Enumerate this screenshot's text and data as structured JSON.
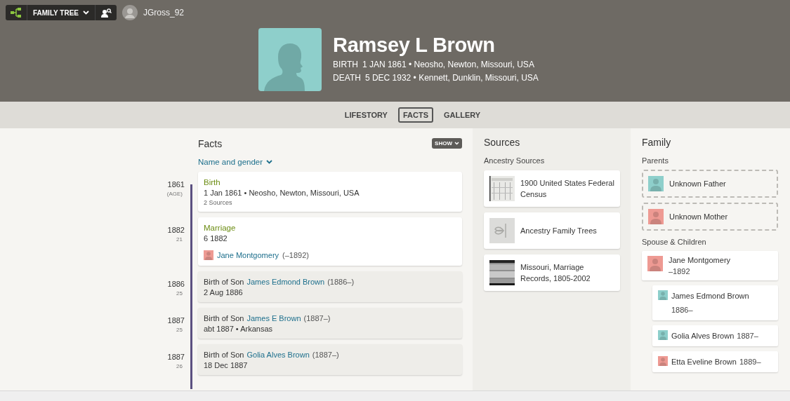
{
  "top_bar": {
    "menu_label": "FAMILY TREE",
    "username": "JGross_92"
  },
  "profile": {
    "name": "Ramsey L Brown",
    "color": "#8ecfcb",
    "events": [
      {
        "label": "BIRTH",
        "text": "1 JAN 1861 • Neosho, Newton, Missouri, USA"
      },
      {
        "label": "DEATH",
        "text": "5 DEC 1932 • Kennett, Dunklin, Missouri, USA"
      }
    ]
  },
  "tabs": [
    {
      "label": "LIFESTORY",
      "selected": false
    },
    {
      "label": "FACTS",
      "selected": true
    },
    {
      "label": "GALLERY",
      "selected": false
    }
  ],
  "facts": {
    "title": "Facts",
    "show_button": "SHOW",
    "filter": "Name and gender",
    "events": [
      {
        "kind": "fact",
        "year": "1861",
        "age": "(AGE)",
        "title": "Birth",
        "detail": "1 Jan 1861 • Neosho, Newton, Missouri, USA",
        "note": "2 Sources"
      },
      {
        "kind": "fact",
        "year": "1882",
        "age": "21",
        "title": "Marriage",
        "detail": "6 1882",
        "person": {
          "name": "Jane Montgomery",
          "dates": "(–1892)",
          "color": "#ee9a93"
        }
      },
      {
        "kind": "child",
        "year": "1886",
        "age": "25",
        "prefix": "Birth of Son",
        "name": "James Edmond Brown",
        "dates": "(1886–)",
        "detail": "2 Aug 1886"
      },
      {
        "kind": "child",
        "year": "1887",
        "age": "25",
        "prefix": "Birth of Son",
        "name": "James E Brown",
        "dates": "(1887–)",
        "detail": "abt 1887 • Arkansas"
      },
      {
        "kind": "child",
        "year": "1887",
        "age": "26",
        "prefix": "Birth of Son",
        "name": "Golia Alves Brown",
        "dates": "(1887–)",
        "detail": "18 Dec 1887"
      }
    ]
  },
  "sources": {
    "title": "Sources",
    "subtitle": "Ancestry Sources",
    "items": [
      {
        "kind": "census",
        "title": "1900 United States Federal Census"
      },
      {
        "kind": "tree",
        "title": "Ancestry Family Trees"
      },
      {
        "kind": "record",
        "title": "Missouri, Marriage Records, 1805-2002"
      }
    ]
  },
  "family": {
    "title": "Family",
    "parents_label": "Parents",
    "parents": [
      {
        "name": "Unknown Father",
        "color": "#8ecfcb"
      },
      {
        "name": "Unknown Mother",
        "color": "#ee9a93"
      }
    ],
    "spouse_label": "Spouse & Children",
    "spouse": {
      "name": "Jane Montgomery",
      "dates": "–1892",
      "color": "#ee9a93",
      "children": [
        {
          "name": "James Edmond Brown",
          "dates": "1886–",
          "color": "#8ecfcb"
        },
        {
          "name": "Golia Alves Brown",
          "dates": "1887–",
          "color": "#8ecfcb"
        },
        {
          "name": "Etta Eveline Brown",
          "dates": "1889–",
          "color": "#ee9a93"
        }
      ]
    }
  }
}
